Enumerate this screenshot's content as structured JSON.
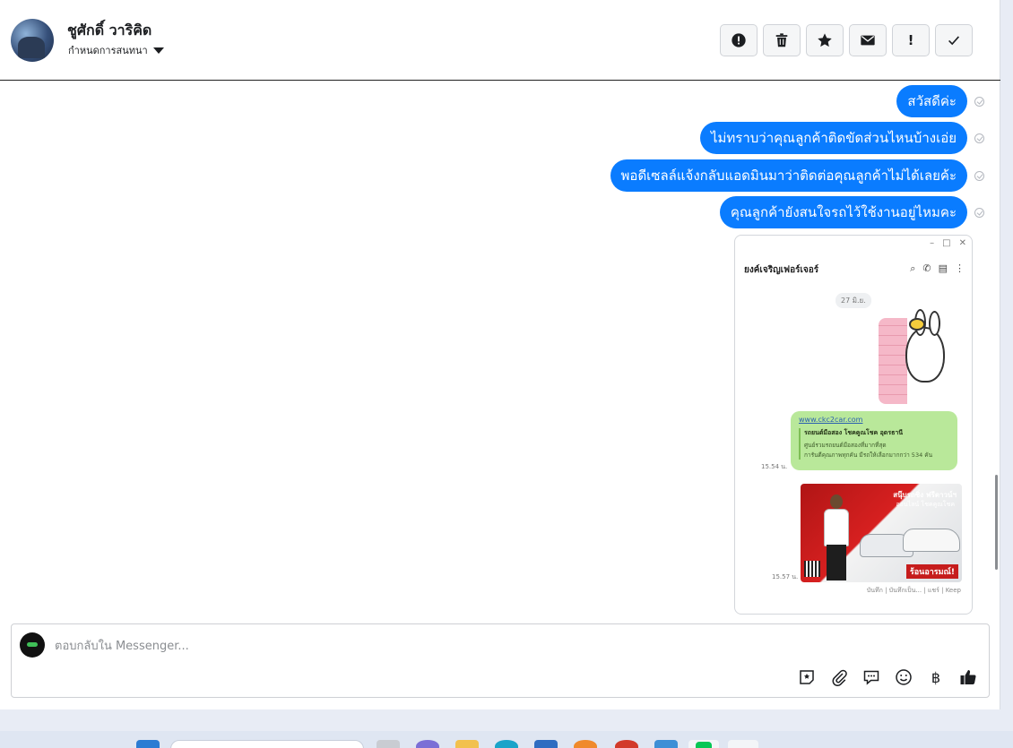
{
  "header": {
    "contact_name": "ชูศักดิ์ วาริคิด",
    "conversation_settings": "กำหนดการสนทนา",
    "toolbar": [
      {
        "name": "report-button",
        "icon": "alert-circle-icon",
        "glyph": "!"
      },
      {
        "name": "delete-button",
        "icon": "trash-icon",
        "glyph": ""
      },
      {
        "name": "star-button",
        "icon": "star-icon",
        "glyph": "★"
      },
      {
        "name": "mail-button",
        "icon": "envelope-icon",
        "glyph": "✉"
      },
      {
        "name": "important-button",
        "icon": "exclamation-icon",
        "glyph": "!"
      },
      {
        "name": "done-button",
        "icon": "check-icon",
        "glyph": "✓"
      }
    ]
  },
  "messages": [
    {
      "text": "สวัสดีค่ะ"
    },
    {
      "text": "ไม่ทราบว่าคุณลูกค้าติดขัดส่วนไหนบ้างเอ่ย"
    },
    {
      "text": "พอดีเซลล์แจ้งกลับแอดมินมาว่าติดต่อคุณลูกค้าไม่ได้เลยค้ะ"
    },
    {
      "text": "คุณลูกค้ายังสนใจรถไว้ใช้งานอยู่ไหมคะ"
    }
  ],
  "screenshot": {
    "window_controls": [
      "–",
      "□",
      "✕"
    ],
    "chat_title": "ยงค์เจริญเฟอร์เจอร์",
    "date_chip": "27 มิ.ย.",
    "link": "www.ckc2car.com",
    "card_title": "รถยนต์มือสอง โชคคูณโชค อุดรธานี",
    "card_line1": "ศูนย์รวมรถยนต์มือสองที่มากที่สุด",
    "card_line2": "การันตีคุณภาพทุกคัน มีรถให้เลือกมากกว่า 534 คัน",
    "time1": "15.54 น.",
    "ad_headline": "สนุ๊บรถซิ่ง ฟรีดาวน์ฯ",
    "ad_sub": "ออนไลน์ โชคคูณโชค",
    "ad_footer": "ร้อนอารมณ์!",
    "time2": "15.57 น.",
    "footer": "บันทึก | บันทึกเป็น... | แชร์ | Keep"
  },
  "composer": {
    "placeholder": "ตอบกลับใน Messenger...",
    "icons": [
      "sticker-icon",
      "attachment-icon",
      "saved-reply-icon",
      "emoji-icon",
      "baht-icon",
      "thumbs-up-icon"
    ]
  }
}
